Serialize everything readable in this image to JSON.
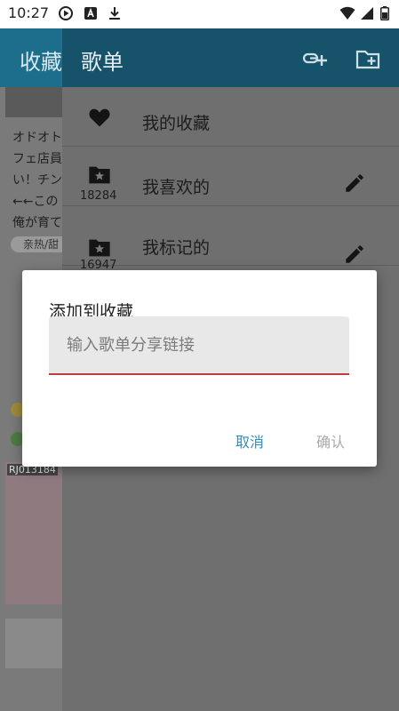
{
  "status_bar": {
    "time": "10:27",
    "icons": [
      "play-circle-icon",
      "a-letter-icon",
      "download-icon",
      "wifi-icon",
      "signal-icon",
      "battery-icon"
    ]
  },
  "background_page": {
    "title": "收藏",
    "text_lines": [
      "オドオト",
      "フェ店員",
      "い！チン",
      "←←この",
      "俺が育て"
    ],
    "chip_label": "亲热/甜",
    "item_code": "RJ013184"
  },
  "drawer": {
    "title": "歌单",
    "actions": [
      "link-add-icon",
      "folder-add-icon"
    ],
    "playlists": [
      {
        "name": "我的收藏",
        "count": "",
        "icon": "heart-icon",
        "editable": false
      },
      {
        "name": "我喜欢的",
        "count": "18284",
        "icon": "folder-star-icon",
        "editable": true
      },
      {
        "name": "我标记的",
        "count": "16947",
        "icon": "folder-star-icon",
        "editable": true
      }
    ]
  },
  "dialog": {
    "title": "添加到收藏",
    "input_placeholder": "输入歌单分享链接",
    "input_value": "",
    "cancel_label": "取消",
    "confirm_label": "确认"
  },
  "colors": {
    "toolbar": "#1c6e8c",
    "drawer_toolbar": "#16526a",
    "accent": "#2b8fc1",
    "field_underline": "#b8413f",
    "disabled": "#a9a9a9"
  }
}
